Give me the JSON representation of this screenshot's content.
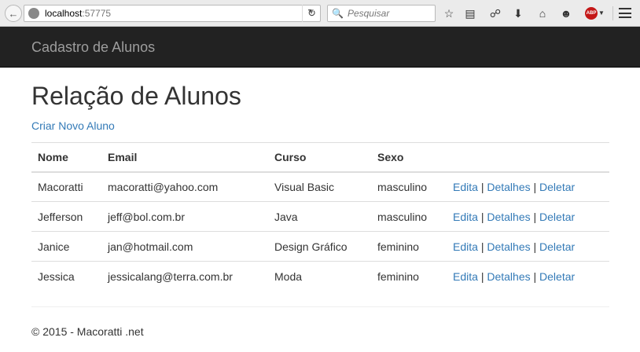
{
  "browser": {
    "url_host": "localhost",
    "url_port": ":57775",
    "search_placeholder": "Pesquisar",
    "abp_label": "ABP"
  },
  "navbar": {
    "brand": "Cadastro de Alunos"
  },
  "page": {
    "title": "Relação de Alunos",
    "create_link": "Criar Novo Aluno"
  },
  "table": {
    "headers": [
      "Nome",
      "Email",
      "Curso",
      "Sexo"
    ],
    "rows": [
      {
        "nome": "Macoratti",
        "email": "macoratti@yahoo.com",
        "curso": "Visual Basic",
        "sexo": "masculino"
      },
      {
        "nome": "Jefferson",
        "email": "jeff@bol.com.br",
        "curso": "Java",
        "sexo": "masculino"
      },
      {
        "nome": "Janice",
        "email": "jan@hotmail.com",
        "curso": "Design Gráfico",
        "sexo": "feminino"
      },
      {
        "nome": "Jessica",
        "email": "jessicalang@terra.com.br",
        "curso": "Moda",
        "sexo": "feminino"
      }
    ],
    "actions": {
      "edit": "Edita",
      "details": "Detalhes",
      "delete": "Deletar",
      "separator": "|"
    }
  },
  "footer": {
    "text": "© 2015 - Macoratti .net"
  },
  "colors": {
    "link": "#337ab7",
    "navbar_bg": "#222222",
    "brand_text": "#9d9d9d"
  }
}
